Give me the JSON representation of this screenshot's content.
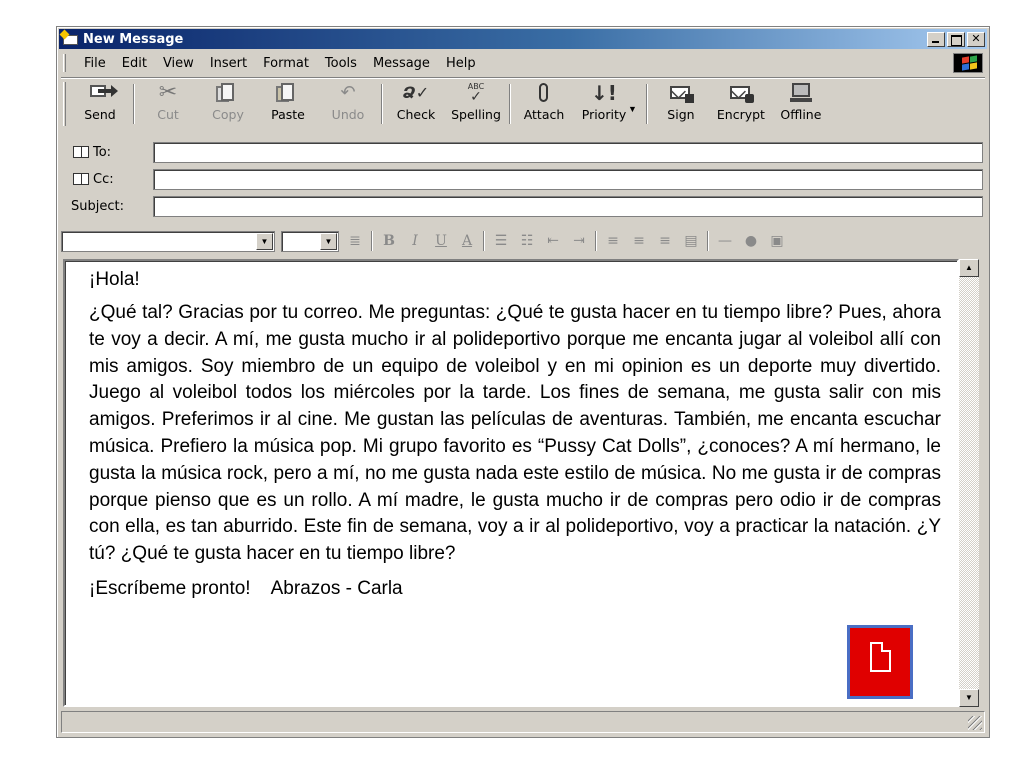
{
  "window": {
    "title": "New Message"
  },
  "menu": [
    "File",
    "Edit",
    "View",
    "Insert",
    "Format",
    "Tools",
    "Message",
    "Help"
  ],
  "toolbar": {
    "send": "Send",
    "cut": "Cut",
    "copy": "Copy",
    "paste": "Paste",
    "undo": "Undo",
    "check": "Check",
    "spelling": "Spelling",
    "spelling_icon_text": "ABC",
    "attach": "Attach",
    "priority": "Priority",
    "sign": "Sign",
    "encrypt": "Encrypt",
    "offline": "Offline"
  },
  "fields": {
    "to_label": "To:",
    "cc_label": "Cc:",
    "subject_label": "Subject:",
    "to_value": "",
    "cc_value": "",
    "subject_value": ""
  },
  "message": {
    "greeting": "¡Hola!",
    "body": "¿Qué tal? Gracias por tu correo. Me preguntas: ¿Qué te gusta hacer en tu tiempo libre? Pues, ahora te voy a decir. A mí, me gusta mucho ir al polideportivo porque me encanta jugar al voleibol allí con mis amigos.  Soy miembro de un equipo de voleibol y en mi opinion es un deporte muy divertido.  Juego al voleibol todos los miércoles por la tarde.  Los fines de semana, me gusta salir con mis amigos. Preferimos ir al cine. Me gustan las películas de aventuras.  También, me encanta escuchar música.  Prefiero la música pop.  Mi grupo favorito es “Pussy Cat Dolls”, ¿conoces?  A mí hermano, le gusta la música rock, pero a mí, no me gusta nada este estilo de música.  No me gusta ir de compras porque pienso que es un rollo.  A mí madre, le gusta mucho ir de compras pero odio ir de compras con ella, es tan aburrido.  Este fin de semana, voy a ir al polideportivo, voy a practicar la natación.  ¿Y tú? ¿Qué te gusta hacer en tu tiempo libre?",
    "closing": "¡Escríbeme pronto!    Abrazos - Carla"
  },
  "colors": {
    "titlebar_start": "#0a246a",
    "titlebar_end": "#a6caf0",
    "document_icon_fill": "#e00000",
    "document_icon_border": "#4a6ec4"
  },
  "icons": {
    "document": "document-icon",
    "windows_logo": "windows-logo-icon",
    "address_book": "address-book-icon"
  }
}
